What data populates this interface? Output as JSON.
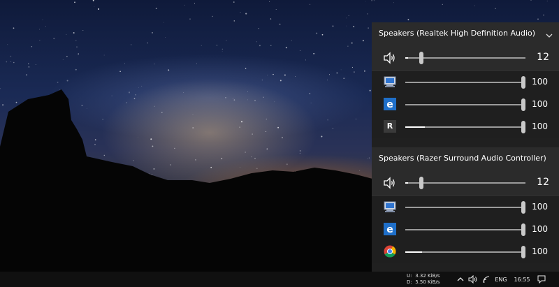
{
  "devices": [
    {
      "name": "Speakers (Realtek High Definition Audio)",
      "has_dropdown": true,
      "master": {
        "icon": "speaker-icon",
        "value": "12",
        "level": 12
      },
      "apps": [
        {
          "icon": "system-sounds-icon",
          "value": "100",
          "level": 100,
          "session_peak": 0
        },
        {
          "icon": "edge-icon",
          "value": "100",
          "level": 100,
          "session_peak": 0
        },
        {
          "icon": "razer-icon",
          "value": "100",
          "level": 100,
          "session_peak": 16,
          "glyph": "R"
        }
      ]
    },
    {
      "name": "Speakers (Razer Surround Audio Controller)",
      "has_dropdown": false,
      "master": {
        "icon": "speaker-icon",
        "value": "12",
        "level": 12
      },
      "apps": [
        {
          "icon": "system-sounds-icon",
          "value": "100",
          "level": 100,
          "session_peak": 0
        },
        {
          "icon": "edge-icon",
          "value": "100",
          "level": 100,
          "session_peak": 0
        },
        {
          "icon": "chrome-icon",
          "value": "100",
          "level": 100,
          "session_peak": 14
        }
      ]
    }
  ],
  "taskbar": {
    "net_upload_label": "U:",
    "net_upload": "3.32 KiB/s",
    "net_download_label": "D:",
    "net_download": "5.50 KiB/s",
    "language": "ENG",
    "time": "16:55"
  },
  "colors": {
    "flyout_bg": "#202020",
    "header_bg": "#2b2b2b",
    "edge_blue": "#1f6fc9",
    "razer_gray": "#3a3a3a"
  }
}
